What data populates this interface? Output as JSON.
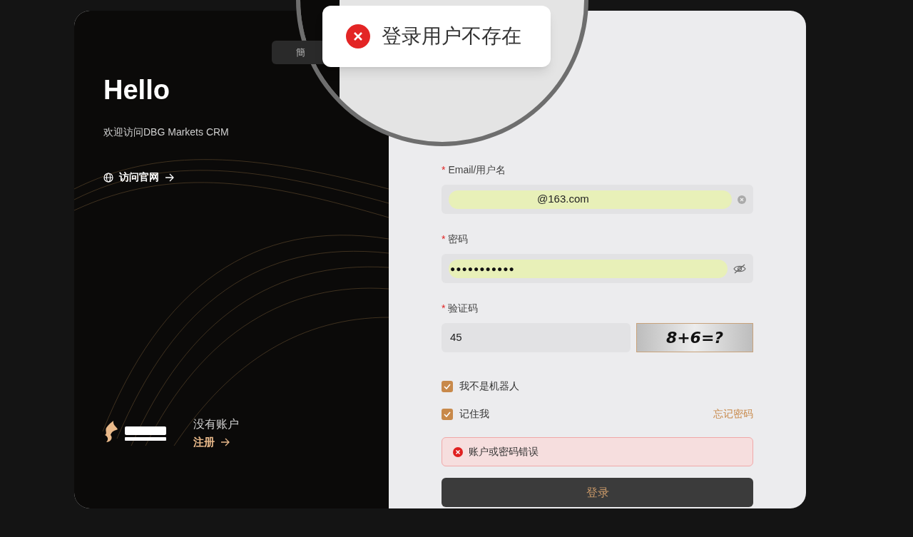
{
  "toast": {
    "message": "登录用户不存在"
  },
  "language_tab": {
    "label": "簡"
  },
  "welcome": {
    "title": "Hello",
    "subtitle": "欢迎访问DBG Markets CRM",
    "website_link": "访问官网"
  },
  "signup": {
    "prompt": "没有账户",
    "link": "注册"
  },
  "form": {
    "fields": [
      {
        "kind": "text",
        "label": "Email/用户名",
        "required_mark": "*",
        "value": "@163.com",
        "autofilled": true
      },
      {
        "kind": "password",
        "label": "密码",
        "required_mark": "*",
        "value": "●●●●●●●●●●●",
        "autofilled": true
      },
      {
        "kind": "captcha",
        "label": "验证码",
        "required_mark": "*",
        "value": "45",
        "autofilled": false,
        "captcha": "8+6=?"
      }
    ],
    "checkboxes": [
      {
        "label": "我不是机器人",
        "checked": true
      },
      {
        "label": "记住我",
        "checked": true
      }
    ],
    "forgot_link": "忘记密码",
    "error": "账户或密码错误",
    "submit": "登录"
  }
}
